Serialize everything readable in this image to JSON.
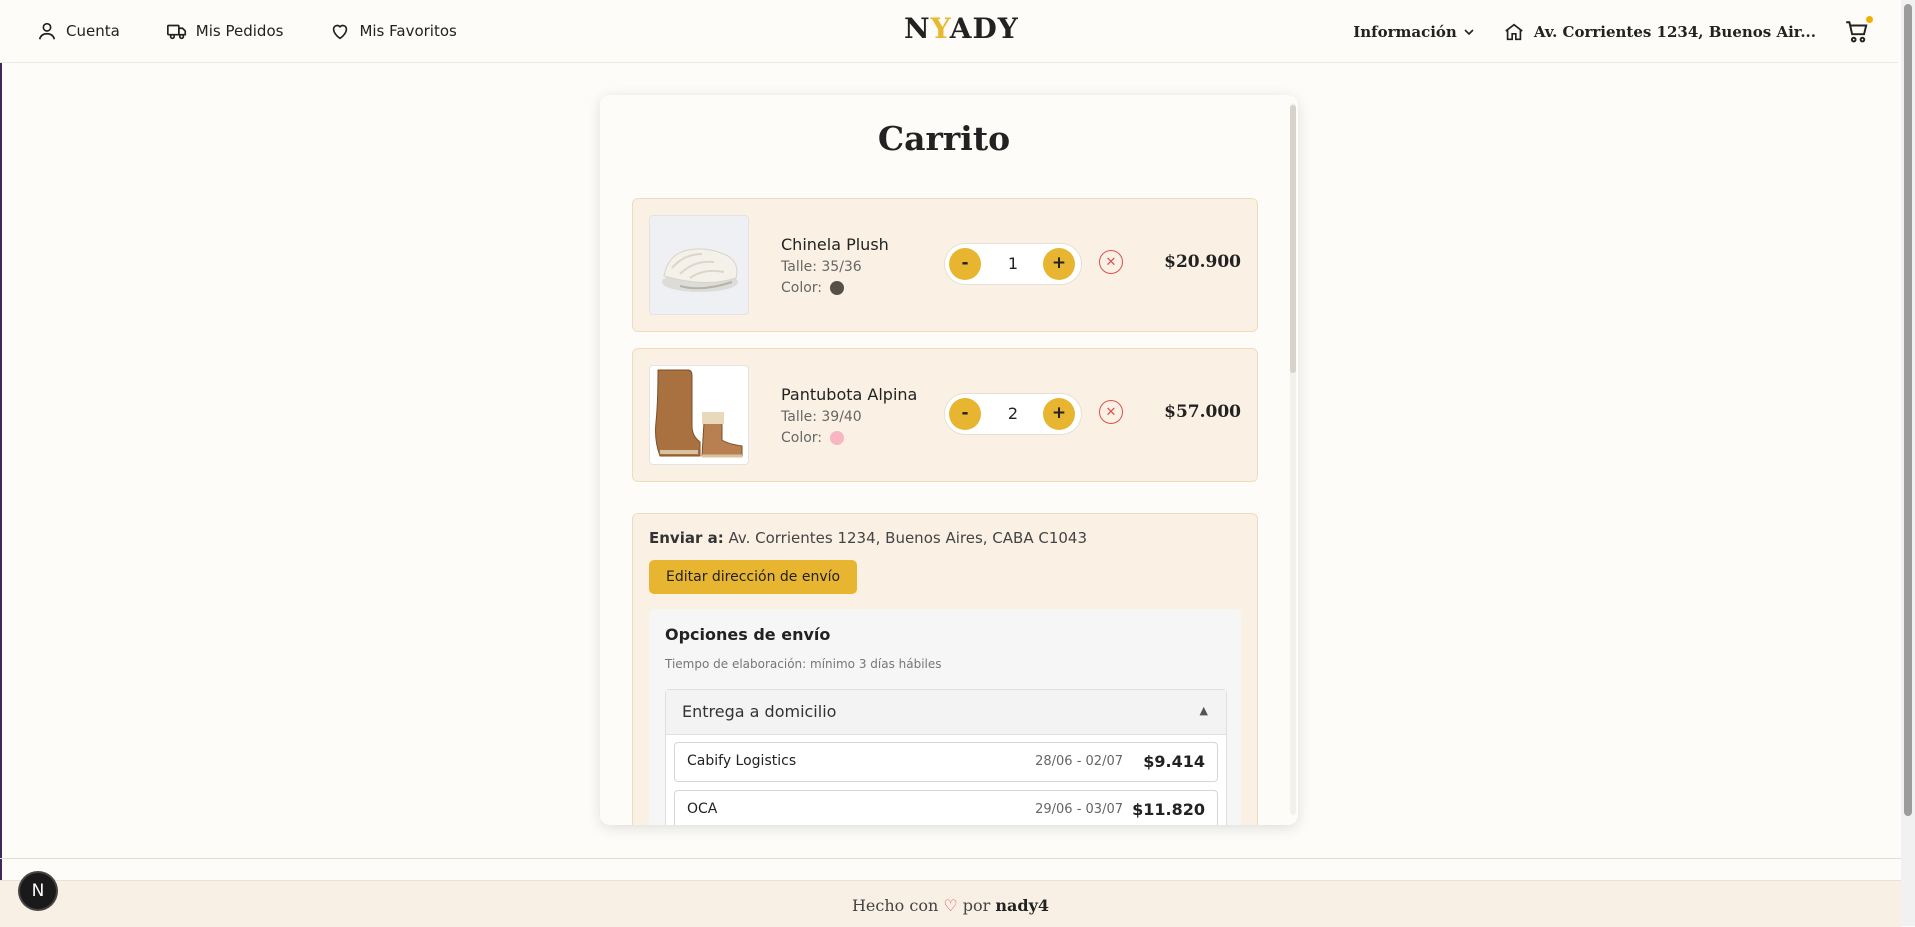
{
  "header": {
    "nav": [
      {
        "label": "Cuenta",
        "icon": "user-icon"
      },
      {
        "label": "Mis Pedidos",
        "icon": "truck-icon"
      },
      {
        "label": "Mis Favoritos",
        "icon": "heart-icon"
      }
    ],
    "logo_left": "N",
    "logo_accent": "Y",
    "logo_right": "ADY",
    "info_label": "Información",
    "address_label": "Av. Corrientes 1234, Buenos Air...",
    "cart_icon": "cart-icon",
    "accent_color": "#e8b530"
  },
  "cart": {
    "title": "Carrito",
    "items": [
      {
        "name": "Chinela Plush",
        "size": "Talle: 35/36",
        "color_label": "Color:",
        "color_swatch": "#555048",
        "qty_minus": "-",
        "quantity": "1",
        "qty_plus": "+",
        "remove": "✕",
        "price": "$20.900"
      },
      {
        "name": "Pantubota Alpina",
        "size": "Talle: 39/40",
        "color_label": "Color:",
        "color_swatch": "#f7b6c2",
        "qty_minus": "-",
        "quantity": "2",
        "qty_plus": "+",
        "remove": "✕",
        "price": "$57.000"
      }
    ]
  },
  "shipping": {
    "send_to_label": "Enviar a:",
    "address": "Av. Corrientes 1234, Buenos Aires, CABA C1043",
    "edit_button": "Editar dirección de envío",
    "options_title": "Opciones de envío",
    "options_note": "Tiempo de elaboración: mínimo 3 días hábiles",
    "method": "Entrega a domicilio",
    "method_arrow": "▲",
    "carriers": [
      {
        "name": "Cabify Logistics",
        "dates": "28/06 - 02/07",
        "price": "$9.414"
      },
      {
        "name": "OCA",
        "dates": "29/06 - 03/07",
        "price": "$11.820"
      }
    ]
  },
  "footer": {
    "made_with": "Hecho con",
    "heart": "♡",
    "by": "por",
    "author": "nady4"
  },
  "dev_badge": "N"
}
